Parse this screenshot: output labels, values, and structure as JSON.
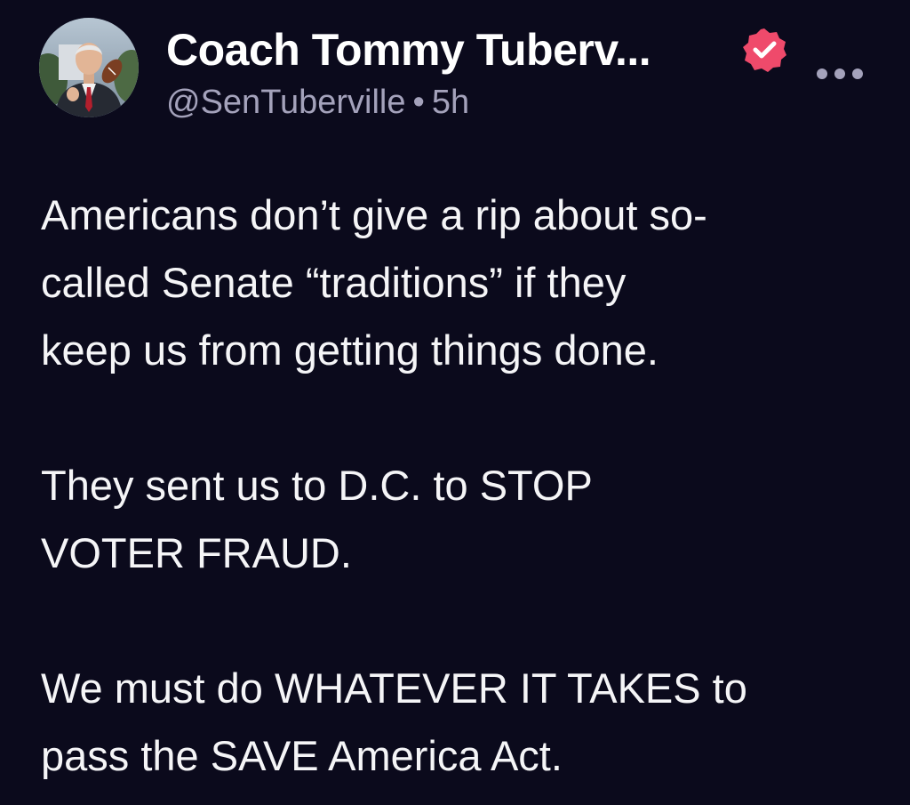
{
  "author": {
    "display_name": "Coach Tommy Tuberv...",
    "handle": "@SenTuberville",
    "separator": "•",
    "time": "5h",
    "verified": true,
    "verified_badge_color": "#ef4a6b",
    "avatar_icon": "profile-photo"
  },
  "post": {
    "paragraphs": [
      "Americans don’t give a rip about so-\ncalled Senate “traditions” if they\nkeep us from getting things done.",
      "They sent us to D.C. to STOP\nVOTER FRAUD.",
      "We must do WHATEVER IT TAKES to\npass the SAVE America Act."
    ]
  },
  "actions": {
    "more_icon": "more-horizontal-icon"
  },
  "colors": {
    "background": "#0b0a1c",
    "text": "#ffffff",
    "muted": "#a4a2bb",
    "accent": "#ef4a6b"
  }
}
